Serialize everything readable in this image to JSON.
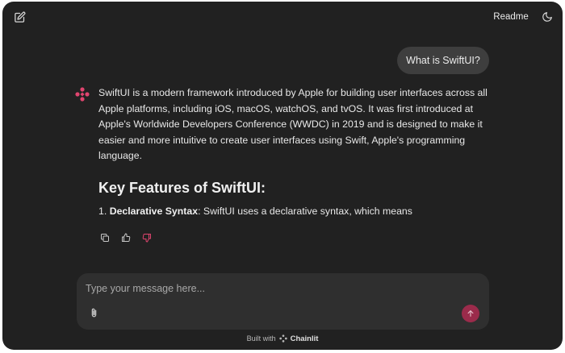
{
  "header": {
    "readme_label": "Readme"
  },
  "icons": {
    "new_chat": "new-chat-icon",
    "theme": "moon-icon",
    "assistant_avatar": "chainlit-logo-icon",
    "copy": "copy-icon",
    "thumbs_up": "thumbs-up-icon",
    "thumbs_down": "thumbs-down-icon",
    "attach": "paperclip-icon",
    "send": "arrow-up-icon"
  },
  "conversation": {
    "user_message": "What is SwiftUI?",
    "assistant": {
      "paragraph": "SwiftUI is a modern framework introduced by Apple for building user interfaces across all Apple platforms, including iOS, macOS, watchOS, and tvOS. It was first introduced at Apple's Worldwide Developers Conference (WWDC) in 2019 and is designed to make it easier and more intuitive to create user interfaces using Swift, Apple's programming language.",
      "heading": "Key Features of SwiftUI:",
      "list_number": "1.",
      "list_item_bold": "Declarative Syntax",
      "list_item_text": ": SwiftUI uses a declarative syntax, which means"
    }
  },
  "composer": {
    "placeholder": "Type your message here...",
    "value": ""
  },
  "footer": {
    "built_with": "Built with",
    "brand": "Chainlit"
  },
  "colors": {
    "background": "#212121",
    "bubble": "#3e3e3e",
    "composer": "#2f2f2f",
    "accent": "#e0456f",
    "send": "#9b2b4b",
    "thumbs_down": "#e0456f"
  }
}
